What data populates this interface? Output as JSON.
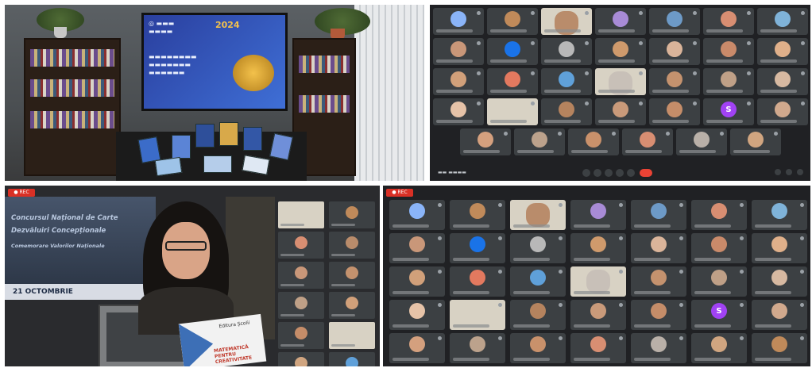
{
  "colors": {
    "meet_dark": "#202124",
    "tile": "#3c4043",
    "record_red": "#d93025",
    "end_call_red": "#ea4335",
    "purple_avatar": "#a142f4",
    "blue_avatar": "#1a73e8"
  },
  "speaker_slide": {
    "line1": "Concursul Național de Carte",
    "line2": "Dezvăluiri Concepționale",
    "line3": "Comemorare Valorilor Naționale",
    "date_line": "21 OCTOMBRIE"
  },
  "held_book": {
    "label": "Editura Școlii",
    "title": "MATEMATICĂ PENTRU CREATIVITATE"
  },
  "meeting_screen": {
    "year": "2024"
  },
  "participants_q2": [
    {
      "initial": "",
      "color": "#8ab4f8"
    },
    {
      "initial": "",
      "color": "#c08a5a"
    },
    {
      "initial": "",
      "color": "#b98c6b",
      "video": true
    },
    {
      "initial": "",
      "color": "#a88bd6"
    },
    {
      "initial": "",
      "color": "#6d9ac7"
    },
    {
      "initial": "",
      "color": "#d88e72"
    },
    {
      "initial": "",
      "color": "#7fb3d9"
    },
    {
      "initial": "",
      "color": "#c99779"
    },
    {
      "initial": "",
      "color": "#1a73e8"
    },
    {
      "initial": "",
      "color": "#b8b8b8"
    },
    {
      "initial": "",
      "color": "#cf9a6c"
    },
    {
      "initial": "",
      "color": "#dab49a"
    },
    {
      "initial": "",
      "color": "#c98a6a"
    },
    {
      "initial": "",
      "color": "#e0b08a"
    },
    {
      "initial": "",
      "color": "#d1a07a"
    },
    {
      "initial": "",
      "color": "#e3795f"
    },
    {
      "initial": "",
      "color": "#5fa0d9"
    },
    {
      "initial": "",
      "color": "#c8c0b8",
      "video": true
    },
    {
      "initial": "",
      "color": "#c4926e"
    },
    {
      "initial": "",
      "color": "#bfa087"
    },
    {
      "initial": "",
      "color": "#d7b9a1"
    },
    {
      "initial": "",
      "color": "#e6c3a8"
    },
    {
      "initial": "",
      "color": "#d8d2c4",
      "video": true
    },
    {
      "initial": "",
      "color": "#b5835e"
    },
    {
      "initial": "",
      "color": "#c99a7a"
    },
    {
      "initial": "",
      "color": "#c58d69"
    },
    {
      "initial": "S",
      "color": "#a142f4"
    },
    {
      "initial": "",
      "color": "#d1a98d"
    },
    {
      "initial": "",
      "color": "#d4a07e"
    },
    {
      "initial": "",
      "color": "#bca28c"
    },
    {
      "initial": "",
      "color": "#c9916b"
    },
    {
      "initial": "",
      "color": "#d88e72"
    },
    {
      "initial": "",
      "color": "#b9b0a8"
    },
    {
      "initial": "",
      "color": "#d0a580"
    }
  ],
  "participants_q4": [
    {
      "initial": "",
      "color": "#8ab4f8"
    },
    {
      "initial": "",
      "color": "#c08a5a"
    },
    {
      "initial": "",
      "color": "#b98c6b",
      "video": true
    },
    {
      "initial": "",
      "color": "#a88bd6"
    },
    {
      "initial": "",
      "color": "#6d9ac7"
    },
    {
      "initial": "",
      "color": "#d88e72"
    },
    {
      "initial": "",
      "color": "#7fb3d9"
    },
    {
      "initial": "",
      "color": "#c99779"
    },
    {
      "initial": "",
      "color": "#1a73e8"
    },
    {
      "initial": "",
      "color": "#b8b8b8"
    },
    {
      "initial": "",
      "color": "#cf9a6c"
    },
    {
      "initial": "",
      "color": "#dab49a"
    },
    {
      "initial": "",
      "color": "#c98a6a"
    },
    {
      "initial": "",
      "color": "#e0b08a"
    },
    {
      "initial": "",
      "color": "#d1a07a"
    },
    {
      "initial": "",
      "color": "#e3795f"
    },
    {
      "initial": "",
      "color": "#5fa0d9"
    },
    {
      "initial": "",
      "color": "#c8c0b8",
      "video": true
    },
    {
      "initial": "",
      "color": "#c4926e"
    },
    {
      "initial": "",
      "color": "#bfa087"
    },
    {
      "initial": "",
      "color": "#d7b9a1"
    },
    {
      "initial": "",
      "color": "#e6c3a8"
    },
    {
      "initial": "",
      "color": "#d8d2c4",
      "video": true
    },
    {
      "initial": "",
      "color": "#b5835e"
    },
    {
      "initial": "",
      "color": "#c99a7a"
    },
    {
      "initial": "",
      "color": "#c58d69"
    },
    {
      "initial": "S",
      "color": "#a142f4"
    },
    {
      "initial": "",
      "color": "#d1a98d"
    },
    {
      "initial": "",
      "color": "#d4a07e"
    },
    {
      "initial": "",
      "color": "#bca28c"
    },
    {
      "initial": "",
      "color": "#c9916b"
    },
    {
      "initial": "",
      "color": "#d88e72"
    },
    {
      "initial": "",
      "color": "#b9b0a8"
    },
    {
      "initial": "",
      "color": "#d0a580"
    },
    {
      "initial": "",
      "color": "#c08a5a"
    }
  ],
  "side_participants": [
    {
      "color": "#d8d2c4",
      "video": true
    },
    {
      "color": "#c08a5a"
    },
    {
      "color": "#d88e72"
    },
    {
      "color": "#b98c6b"
    },
    {
      "color": "#c99779"
    },
    {
      "color": "#c4926e"
    },
    {
      "color": "#bfa087"
    },
    {
      "color": "#d1a07a"
    },
    {
      "color": "#c58d69"
    },
    {
      "color": "#d8d2c4",
      "video": true
    },
    {
      "color": "#d0a580"
    },
    {
      "color": "#5fa0d9"
    }
  ]
}
